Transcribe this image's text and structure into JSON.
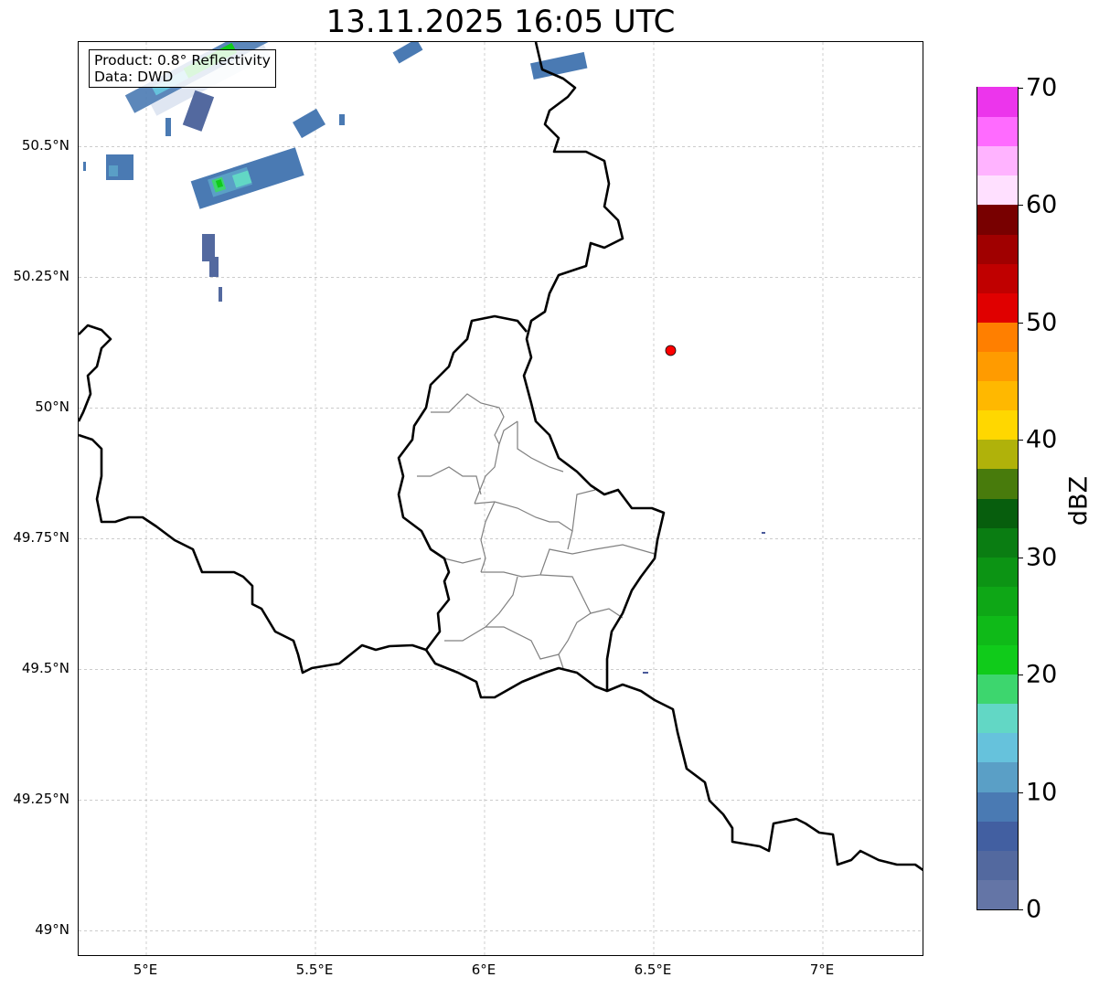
{
  "title": "13.11.2025 16:05 UTC",
  "annotation": {
    "line1": "Product: 0.8° Reflectivity",
    "line2": "Data: DWD"
  },
  "map": {
    "lon_range": [
      4.8,
      7.3
    ],
    "lat_range": [
      48.95,
      50.7
    ],
    "x_ticks": [
      {
        "value": 5,
        "label": "5°E"
      },
      {
        "value": 5.5,
        "label": "5.5°E"
      },
      {
        "value": 6,
        "label": "6°E"
      },
      {
        "value": 6.5,
        "label": "6.5°E"
      },
      {
        "value": 7,
        "label": "7°E"
      }
    ],
    "y_ticks": [
      {
        "value": 50.5,
        "label": "50.5°N"
      },
      {
        "value": 50.25,
        "label": "50.25°N"
      },
      {
        "value": 50,
        "label": "50°N"
      },
      {
        "value": 49.75,
        "label": "49.75°N"
      },
      {
        "value": 49.5,
        "label": "49.5°N"
      },
      {
        "value": 49.25,
        "label": "49.25°N"
      },
      {
        "value": 49,
        "label": "49°N"
      }
    ],
    "grid": true,
    "marker": {
      "lon": 6.55,
      "lat": 50.11,
      "color": "#ff0000"
    },
    "border_color": "#000000",
    "admin_color": "#808080"
  },
  "colorbar": {
    "label": "dBZ",
    "range": [
      0,
      70
    ],
    "ticks": [
      {
        "value": 0,
        "label": "0"
      },
      {
        "value": 10,
        "label": "10"
      },
      {
        "value": 20,
        "label": "20"
      },
      {
        "value": 30,
        "label": "30"
      },
      {
        "value": 40,
        "label": "40"
      },
      {
        "value": 50,
        "label": "50"
      },
      {
        "value": 60,
        "label": "60"
      },
      {
        "value": 70,
        "label": "70"
      }
    ],
    "step": 2.5,
    "colors": [
      "#6475a6",
      "#53699f",
      "#425fa1",
      "#4a7ab3",
      "#5a9fc6",
      "#66c2dc",
      "#62d7c5",
      "#3dd66e",
      "#10cb1a",
      "#0fba18",
      "#0ea716",
      "#0c9414",
      "#0a7d12",
      "#075e0d",
      "#487b0c",
      "#b0b20a",
      "#ffd700",
      "#ffb800",
      "#ff9b00",
      "#ff7f00",
      "#e00000",
      "#c00000",
      "#a00000",
      "#780000",
      "#ffe0ff",
      "#ffb3ff",
      "#ff6bff",
      "#ec35ec"
    ]
  }
}
